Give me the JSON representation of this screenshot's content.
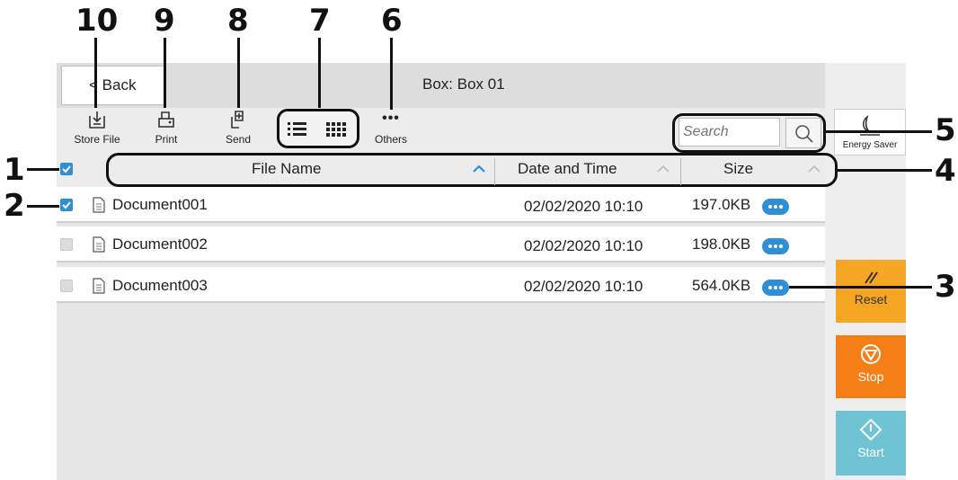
{
  "callouts": {
    "n10": "10",
    "n9": "9",
    "n8": "8",
    "n7": "7",
    "n6": "6",
    "n5": "5",
    "n4": "4",
    "n3": "3",
    "n2": "2",
    "n1": "1"
  },
  "topbar": {
    "back_label": "< Back",
    "box_title": "Box: Box 01"
  },
  "toolbar": {
    "store_file": "Store File",
    "print": "Print",
    "send": "Send",
    "others": "Others",
    "others_glyph": "•••"
  },
  "search": {
    "placeholder": "Search"
  },
  "table": {
    "col_name": "File Name",
    "col_date": "Date and Time",
    "col_size": "Size",
    "rows": [
      {
        "name": "Document001",
        "date": "02/02/2020 10:10",
        "size": "197.0KB",
        "checked": true
      },
      {
        "name": "Document002",
        "date": "02/02/2020 10:10",
        "size": "198.0KB",
        "checked": false
      },
      {
        "name": "Document003",
        "date": "02/02/2020 10:10",
        "size": "564.0KB",
        "checked": false
      }
    ]
  },
  "side": {
    "energy_saver": "Energy Saver",
    "reset": "Reset",
    "stop": "Stop",
    "start": "Start"
  },
  "icons": [
    "store-file-icon",
    "print-icon",
    "send-icon",
    "list-view-icon",
    "grid-view-icon",
    "search-icon",
    "energy-saver-icon",
    "reset-icon",
    "stop-icon",
    "start-icon",
    "document-icon",
    "more-icon"
  ],
  "colors": {
    "accent": "#2e8fd6",
    "reset": "#f5a623",
    "stop": "#f57f16",
    "start": "#6fc3d3"
  }
}
